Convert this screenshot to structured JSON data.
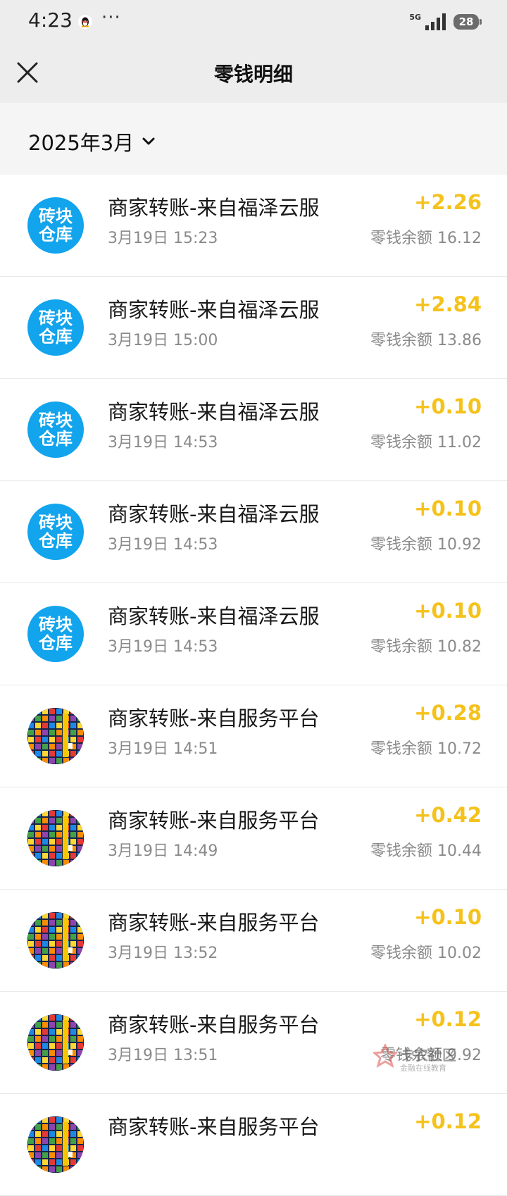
{
  "status_bar": {
    "time": "4:23",
    "dots": "···",
    "network": "5G",
    "battery": "28"
  },
  "header": {
    "title": "零钱明细"
  },
  "month_filter": {
    "label": "2025年3月"
  },
  "transactions": [
    {
      "avatar": "brick",
      "avatar_text": [
        "砖块",
        "仓库"
      ],
      "title": "商家转账-来自福泽云服",
      "time": "3月19日 15:23",
      "amount": "+2.26",
      "balance": "零钱余额 16.12"
    },
    {
      "avatar": "brick",
      "avatar_text": [
        "砖块",
        "仓库"
      ],
      "title": "商家转账-来自福泽云服",
      "time": "3月19日 15:00",
      "amount": "+2.84",
      "balance": "零钱余额 13.86"
    },
    {
      "avatar": "brick",
      "avatar_text": [
        "砖块",
        "仓库"
      ],
      "title": "商家转账-来自福泽云服",
      "time": "3月19日 14:53",
      "amount": "+0.10",
      "balance": "零钱余额 11.02"
    },
    {
      "avatar": "brick",
      "avatar_text": [
        "砖块",
        "仓库"
      ],
      "title": "商家转账-来自福泽云服",
      "time": "3月19日 14:53",
      "amount": "+0.10",
      "balance": "零钱余额 10.92"
    },
    {
      "avatar": "brick",
      "avatar_text": [
        "砖块",
        "仓库"
      ],
      "title": "商家转账-来自福泽云服",
      "time": "3月19日 14:53",
      "amount": "+0.10",
      "balance": "零钱余额 10.82"
    },
    {
      "avatar": "game",
      "title": "商家转账-来自服务平台",
      "time": "3月19日 14:51",
      "amount": "+0.28",
      "balance": "零钱余额 10.72"
    },
    {
      "avatar": "game",
      "title": "商家转账-来自服务平台",
      "time": "3月19日 14:49",
      "amount": "+0.42",
      "balance": "零钱余额 10.44"
    },
    {
      "avatar": "game",
      "title": "商家转账-来自服务平台",
      "time": "3月19日 13:52",
      "amount": "+0.10",
      "balance": "零钱余额 10.02"
    },
    {
      "avatar": "game",
      "title": "商家转账-来自服务平台",
      "time": "3月19日 13:51",
      "amount": "+0.12",
      "balance": "零钱余额 9.92"
    },
    {
      "avatar": "game",
      "title": "商家转账-来自服务平台",
      "time": "",
      "amount": "+0.12",
      "balance": ""
    }
  ],
  "watermark": {
    "title": "卡农社区",
    "subtitle": "金融在线教育"
  },
  "colors": {
    "amount": "#f5c21b",
    "brick_avatar": "#12a4ec",
    "header_bg": "#ededed"
  }
}
